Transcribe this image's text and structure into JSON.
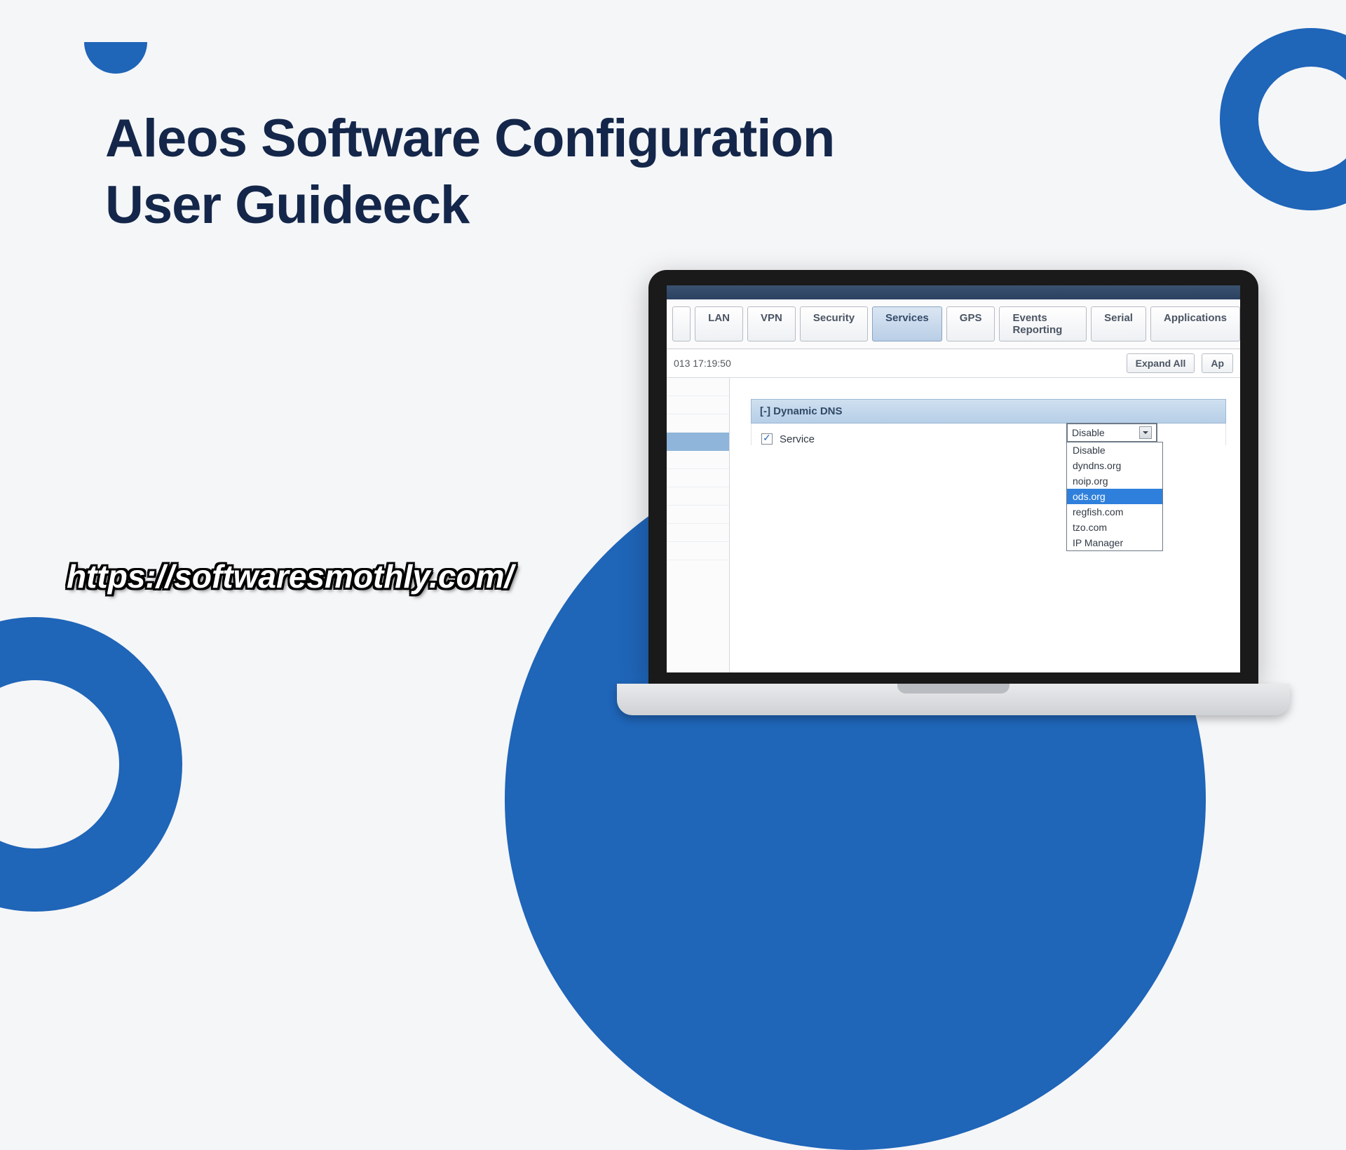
{
  "title_line1": "Aleos Software Configuration",
  "title_line2": "User Guideeck",
  "watermark_url": "https://softwaresmothly.com/",
  "app_window": {
    "tabs": [
      "LAN",
      "VPN",
      "Security",
      "Services",
      "GPS",
      "Events Reporting",
      "Serial",
      "Applications"
    ],
    "active_tab_index": 3,
    "timestamp": "013 17:19:50",
    "buttons": {
      "expand_all": "Expand All",
      "apply": "Ap"
    },
    "section_title": "[-] Dynamic DNS",
    "field": {
      "label": "Service",
      "checked": true
    },
    "dropdown": {
      "selected": "Disable",
      "options": [
        "Disable",
        "dyndns.org",
        "noip.org",
        "ods.org",
        "regfish.com",
        "tzo.com",
        "IP Manager"
      ],
      "highlighted_index": 3
    }
  }
}
